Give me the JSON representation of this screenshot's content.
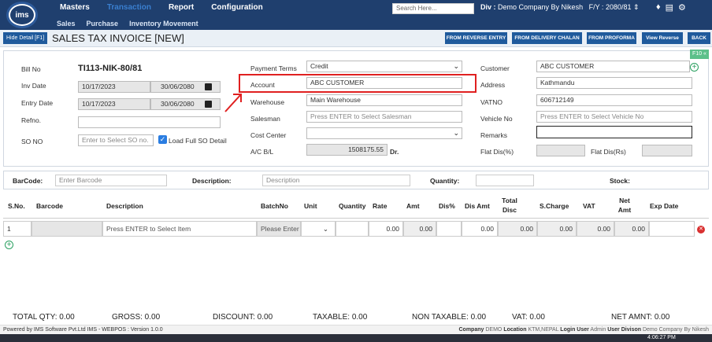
{
  "nav": {
    "logo_text": "ims",
    "menu": [
      "Masters",
      "Transaction",
      "Report",
      "Configuration"
    ],
    "submenu": [
      "Sales",
      "Purchase",
      "Inventory Movement"
    ],
    "search_placeholder": "Search Here...",
    "div_label": "Div :",
    "div_value": "Demo Company By Nikesh",
    "fy_label": "F/Y :",
    "fy_value": "2080/81"
  },
  "toolbar": {
    "hide_detail": "Hide Detail [F1]",
    "title": "SALES TAX INVOICE [NEW]",
    "buttons": [
      "FROM REVERSE ENTRY",
      "FROM DELIVERY CHALAN",
      "FROM PROFORMA",
      "View Reverse",
      "BACK"
    ],
    "f10": "F10 «"
  },
  "form": {
    "bill_no_label": "Bill No",
    "bill_no": "TI113-NIK-80/81",
    "inv_date_label": "Inv Date",
    "inv_date": "10/17/2023",
    "inv_date_bs": "30/06/2080",
    "entry_date_label": "Entry Date",
    "entry_date": "10/17/2023",
    "entry_date_bs": "30/06/2080",
    "refno_label": "Refno.",
    "refno": "",
    "so_no_label": "SO NO",
    "so_no_placeholder": "Enter to Select SO no.",
    "load_full_so": "Load Full SO Detail",
    "payment_terms_label": "Payment Terms",
    "payment_terms": "Credit",
    "account_label": "Account",
    "account": "ABC CUSTOMER",
    "warehouse_label": "Warehouse",
    "warehouse": "Main Warehouse",
    "salesman_label": "Salesman",
    "salesman_placeholder": "Press ENTER to Select Salesman",
    "cost_center_label": "Cost Center",
    "cost_center": "",
    "acbl_label": "A/C B/L",
    "acbl_value": "1508175.55",
    "acbl_suffix": "Dr.",
    "customer_label": "Customer",
    "customer": "ABC CUSTOMER",
    "address_label": "Address",
    "address": "Kathmandu",
    "vatno_label": "VATNO",
    "vatno": "606712149",
    "vehicle_label": "Vehicle No",
    "vehicle_placeholder": "Press ENTER to Select Vehicle No",
    "remarks_label": "Remarks",
    "remarks": "",
    "flat_dis_pct_label": "Flat Dis(%)",
    "flat_dis_rs_label": "Flat Dis(Rs)"
  },
  "barcode_strip": {
    "barcode_label": "BarCode:",
    "barcode_placeholder": "Enter Barcode",
    "description_label": "Description:",
    "description_placeholder": "Description",
    "quantity_label": "Quantity:",
    "stock_label": "Stock:"
  },
  "grid": {
    "headers": [
      "S.No.",
      "Barcode",
      "Description",
      "BatchNo",
      "Unit",
      "Quantity",
      "Rate",
      "Amt",
      "Dis%",
      "Dis Amt",
      "Total Disc",
      "S.Charge",
      "VAT",
      "Net Amt",
      "Exp Date"
    ],
    "row": {
      "sno": "1",
      "barcode": "",
      "description_placeholder": "Press ENTER to Select Item",
      "batch_placeholder": "Please Enter",
      "rate": "0.00",
      "amt": "0.00",
      "dis_amt": "0.00",
      "total_disc": "0.00",
      "s_charge": "0.00",
      "vat": "0.00",
      "net_amt": "0.00"
    }
  },
  "totals": {
    "total_qty": "TOTAL QTY: 0.00",
    "gross": "GROSS: 0.00",
    "discount": "DISCOUNT: 0.00",
    "taxable": "TAXABLE: 0.00",
    "non_taxable": "NON TAXABLE: 0.00",
    "vat": "VAT: 0.00",
    "net_amnt": "NET AMNT: 0.00"
  },
  "footer": {
    "left": "Powered by IMS Software Pvt.Ltd   IMS - WEBPOS : Version 1.0.0",
    "company_label": "Company",
    "company": "DEMO",
    "location_label": "Location",
    "location": "KTM,NEPAL",
    "login_label": "Login User",
    "login": "Admin",
    "division_label": "User Divison",
    "division": "Demo Company By Nikesh",
    "clock": "4:06:27 PM"
  },
  "colors": {
    "nav": "#1f3f6e",
    "button": "#1f5a9c",
    "highlight": "#e02020"
  }
}
